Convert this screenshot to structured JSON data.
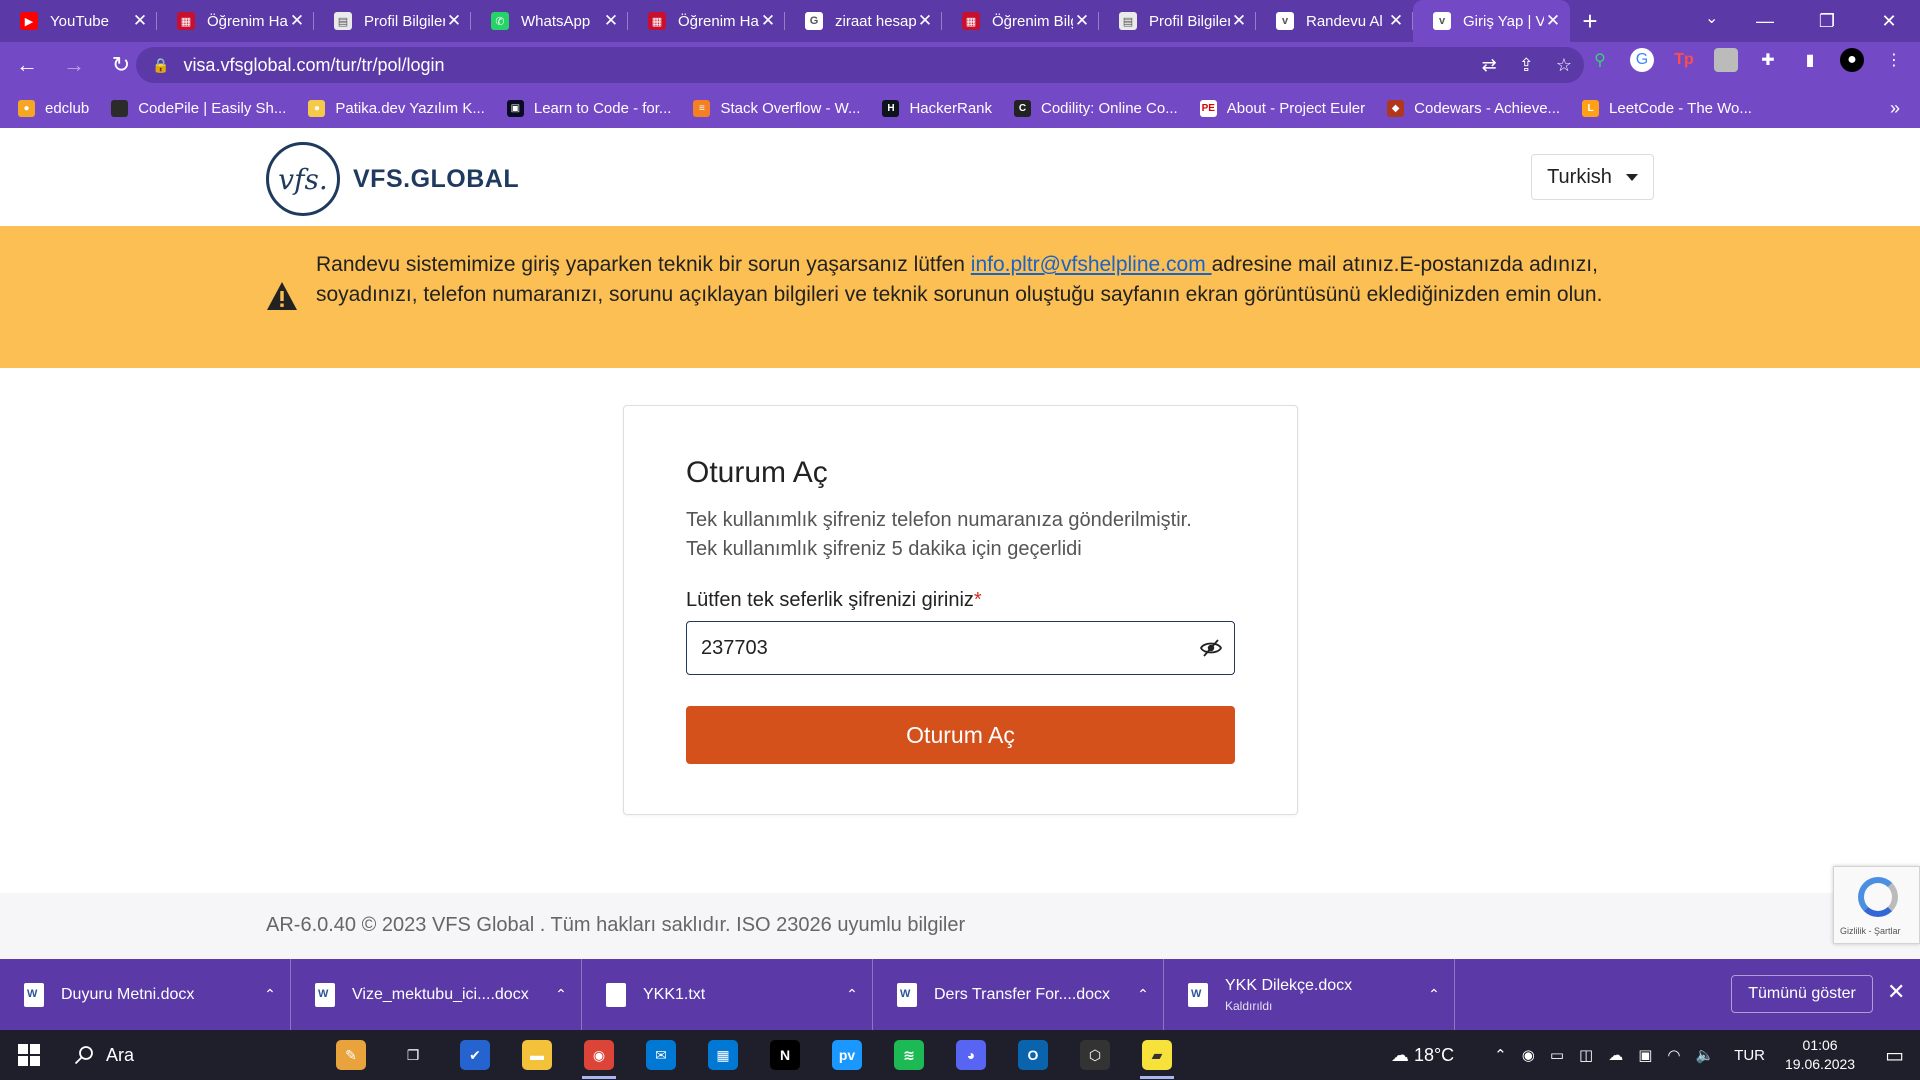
{
  "browser": {
    "tabs": [
      {
        "title": "YouTube",
        "icon": "youtube-icon",
        "color": "#ff0000",
        "glyph": "▶"
      },
      {
        "title": "Öğrenim Hareketliliği",
        "icon": "grid-logo-icon",
        "color": "#c8102e",
        "glyph": "▦"
      },
      {
        "title": "Profil Bilgileri",
        "icon": "page-icon",
        "color": "#eaeaea",
        "glyph": "▤"
      },
      {
        "title": "WhatsApp",
        "icon": "whatsapp-icon",
        "color": "#25d366",
        "glyph": "✆"
      },
      {
        "title": "Öğrenim Hareketliliği",
        "icon": "grid-logo-icon",
        "color": "#c8102e",
        "glyph": "▦"
      },
      {
        "title": "ziraat hesap",
        "icon": "google-icon",
        "color": "#ffffff",
        "glyph": "G"
      },
      {
        "title": "Öğrenim Bilgileri",
        "icon": "grid-logo-icon",
        "color": "#c8102e",
        "glyph": "▦"
      },
      {
        "title": "Profil Bilgileri",
        "icon": "page-icon",
        "color": "#eaeaea",
        "glyph": "▤"
      },
      {
        "title": "Randevu Al",
        "icon": "vfs-icon",
        "color": "#ffffff",
        "glyph": "v"
      },
      {
        "title": "Giriş Yap | VFS",
        "icon": "vfs-icon",
        "color": "#ffffff",
        "glyph": "v",
        "active": true
      }
    ],
    "url": "visa.vfsglobal.com/tur/tr/pol/login",
    "bookmarks": [
      {
        "label": "edclub",
        "color": "#f5a623",
        "glyph": "●"
      },
      {
        "label": "CodePile | Easily Sh...",
        "color": "#2b2b2b",
        "glyph": "</>"
      },
      {
        "label": "Patika.dev Yazılım K...",
        "color": "#f7c948",
        "glyph": "●"
      },
      {
        "label": "Learn to Code - for...",
        "color": "#0a0a23",
        "glyph": "▣"
      },
      {
        "label": "Stack Overflow - W...",
        "color": "#f48024",
        "glyph": "≡"
      },
      {
        "label": "HackerRank",
        "color": "#0e141e",
        "glyph": "H"
      },
      {
        "label": "Codility: Online Co...",
        "color": "#222222",
        "glyph": "C"
      },
      {
        "label": "About - Project Euler",
        "color": "#ffffff",
        "glyph": "PE"
      },
      {
        "label": "Codewars - Achieve...",
        "color": "#b1361e",
        "glyph": "◆"
      },
      {
        "label": "LeetCode - The Wo...",
        "color": "#ffa116",
        "glyph": "L"
      }
    ],
    "bookmarks_more": "»"
  },
  "page": {
    "logo_mark": "vfs.",
    "logo_text": "VFS.GLOBAL",
    "language": "Turkish",
    "banner": {
      "text_before": "Randevu sistemimize giriş yaparken teknik bir sorun yaşarsanız lütfen ",
      "email": "info.pltr@vfshelpline.com ",
      "text_after": "adresine mail atınız.E-postanızda adınızı, soyadınızı, telefon numaranızı, sorunu açıklayan bilgileri ve teknik sorunun oluştuğu sayfanın ekran görüntüsünü eklediğinizden emin olun."
    },
    "login": {
      "title": "Oturum Aç",
      "info_line1": "Tek kullanımlık şifreniz telefon numaranıza gönderilmiştir.",
      "info_line2": "Tek kullanımlık şifreniz 5 dakika için geçerlidi",
      "field_label": "Lütfen tek seferlik şifrenizi giriniz",
      "required_mark": "*",
      "otp_value": "237703",
      "submit_label": "Oturum Aç"
    },
    "footer": "AR-6.0.40 © 2023 VFS Global . Tüm hakları saklıdır. ISO 23026 uyumlu bilgiler",
    "recaptcha_text": "Gizlilik - Şartlar",
    "colors": {
      "accent": "#d4511c",
      "banner": "#fcbf53",
      "brand": "#1f3a5f",
      "chrome": "#7349c6"
    }
  },
  "downloads": {
    "items": [
      {
        "name": "Duyuru Metni.docx",
        "status": "",
        "type": "word"
      },
      {
        "name": "Vize_mektubu_ici....docx",
        "status": "",
        "type": "word"
      },
      {
        "name": "YKK1.txt",
        "status": "",
        "type": "text"
      },
      {
        "name": "Ders Transfer For....docx",
        "status": "",
        "type": "word"
      },
      {
        "name": "YKK Dilekçe.docx",
        "status": "Kaldırıldı",
        "type": "word"
      }
    ],
    "show_all": "Tümünü göster"
  },
  "taskbar": {
    "search_placeholder": "Ara",
    "apps": [
      {
        "name": "widgets",
        "color": "#e8a33d",
        "glyph": "✎"
      },
      {
        "name": "task-view",
        "color": "transparent",
        "glyph": "❐"
      },
      {
        "name": "todo",
        "color": "#2564cf",
        "glyph": "✔"
      },
      {
        "name": "file-explorer",
        "color": "#f3c13a",
        "glyph": "▬"
      },
      {
        "name": "chrome",
        "color": "#db4437",
        "glyph": "◉",
        "running": true
      },
      {
        "name": "mail",
        "color": "#0078d4",
        "glyph": "✉"
      },
      {
        "name": "calendar",
        "color": "#0078d4",
        "glyph": "▦"
      },
      {
        "name": "netflix",
        "color": "#000000",
        "glyph": "N"
      },
      {
        "name": "prime-video",
        "color": "#1a98ff",
        "glyph": "pv"
      },
      {
        "name": "spotify",
        "color": "#1db954",
        "glyph": "≋"
      },
      {
        "name": "discord",
        "color": "#5865f2",
        "glyph": "◕"
      },
      {
        "name": "outlook",
        "color": "#0a64ad",
        "glyph": "O"
      },
      {
        "name": "unity",
        "color": "#333333",
        "glyph": "⬡"
      },
      {
        "name": "sticky-notes",
        "color": "#f7e13b",
        "glyph": "▰",
        "running": true
      }
    ],
    "weather": "18°C",
    "language": "TUR",
    "time": "01:06",
    "date": "19.06.2023"
  }
}
